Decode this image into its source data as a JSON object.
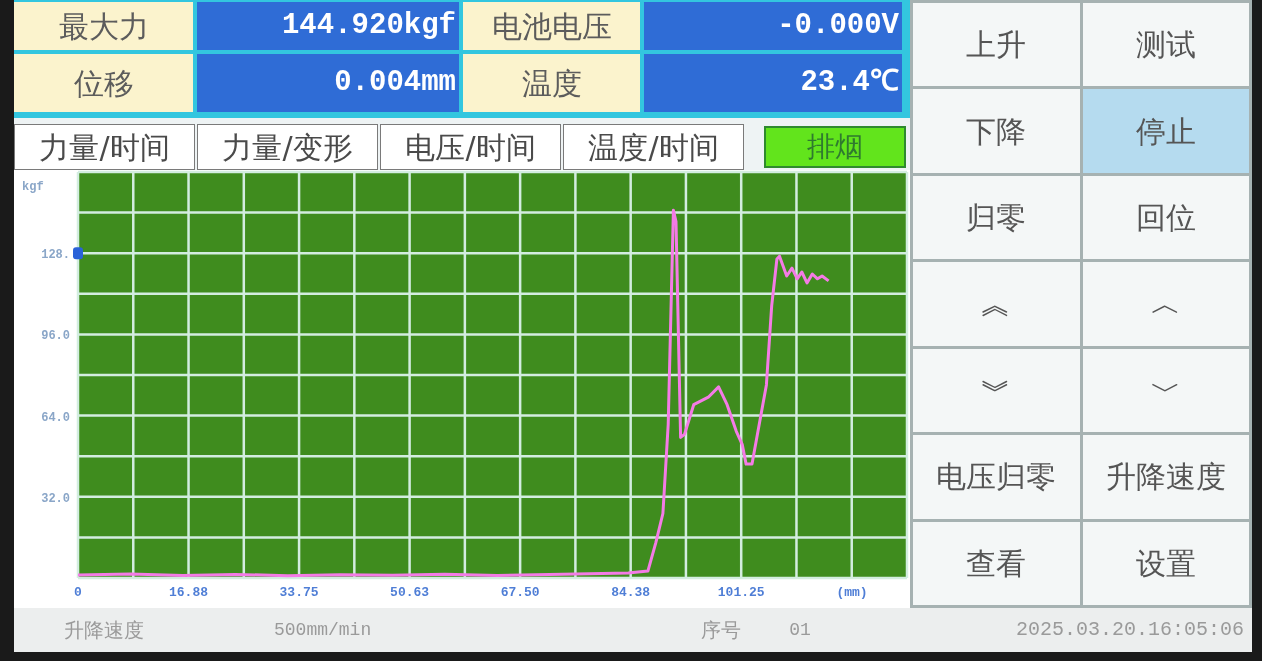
{
  "readings": [
    {
      "label": "最大力",
      "value": "144.920kgf"
    },
    {
      "label": "电池电压",
      "value": "-0.000V"
    },
    {
      "label": "位移",
      "value": "0.004mm"
    },
    {
      "label": "温度",
      "value": "23.4℃"
    }
  ],
  "chart_tabs": [
    {
      "label": "力量/时间"
    },
    {
      "label": "力量/变形"
    },
    {
      "label": "电压/时间"
    },
    {
      "label": "温度/时间"
    }
  ],
  "exhaust_button": {
    "label": "排烟",
    "on": true
  },
  "chart": {
    "chart_data": {
      "type": "line",
      "xlabel": "(mm)",
      "ylabel": "kgf",
      "grid": true,
      "x": [
        0,
        8,
        16,
        24,
        32,
        40,
        48,
        56,
        64,
        72,
        80,
        84,
        87,
        88.2,
        89.3,
        90.1,
        90.9,
        91.3,
        92,
        92.6,
        94,
        96.3,
        97.8,
        99.1,
        100.5,
        101.4,
        102,
        102.9,
        104,
        105.1,
        105.9,
        106.7,
        107.1,
        108.2,
        109,
        109.8,
        110.5,
        111.3,
        112.1,
        112.9,
        113.6,
        114.6
      ],
      "series": [
        {
          "color": "#f47be6",
          "values": [
            1.2,
            1.6,
            1.0,
            1.4,
            0.9,
            1.3,
            1.1,
            1.5,
            1.0,
            1.4,
            1.8,
            2.0,
            2.7,
            13.7,
            25.4,
            60.5,
            144.9,
            140.5,
            55.4,
            56.6,
            68.3,
            71.4,
            75.3,
            68.3,
            57.8,
            52.7,
            44.9,
            44.9,
            60.5,
            76.1,
            107.3,
            125.7,
            126.8,
            119.0,
            122.1,
            117.9,
            120.6,
            116.3,
            119.8,
            117.9,
            119.0,
            117.1
          ]
        }
      ],
      "xlim": [
        0,
        126.5625
      ],
      "ylim": [
        0,
        160
      ],
      "xticks": [
        {
          "value": 0,
          "label": "0"
        },
        {
          "value": 16.875,
          "label": "16.88"
        },
        {
          "value": 33.75,
          "label": "33.75"
        },
        {
          "value": 50.625,
          "label": "50.63"
        },
        {
          "value": 67.5,
          "label": "67.50"
        },
        {
          "value": 84.375,
          "label": "84.38"
        },
        {
          "value": 101.25,
          "label": "101.25"
        }
      ],
      "yticks": [
        {
          "value": 32,
          "label": "32.0"
        },
        {
          "value": 64,
          "label": "64.0"
        },
        {
          "value": 96,
          "label": "96.0"
        },
        {
          "value": 128,
          "label": "128."
        }
      ]
    }
  },
  "control_buttons": [
    {
      "label": "上升",
      "selected": false
    },
    {
      "label": "测试",
      "selected": false
    },
    {
      "label": "下降",
      "selected": false
    },
    {
      "label": "停止",
      "selected": true
    },
    {
      "label": "归零",
      "selected": false
    },
    {
      "label": "回位",
      "selected": false
    },
    {
      "label": "︽",
      "selected": false
    },
    {
      "label": "︿",
      "selected": false
    },
    {
      "label": "︾",
      "selected": false
    },
    {
      "label": "﹀",
      "selected": false
    },
    {
      "label": "电压归零",
      "selected": false
    },
    {
      "label": "升降速度",
      "selected": false
    },
    {
      "label": "查看",
      "selected": false
    },
    {
      "label": "设置",
      "selected": false
    }
  ],
  "status_bar": {
    "speed_label": "升降速度",
    "speed_value": "500mm/min",
    "serial_label": "序号",
    "serial_value": "01",
    "datetime": "2025.03.20.16:05:06"
  }
}
